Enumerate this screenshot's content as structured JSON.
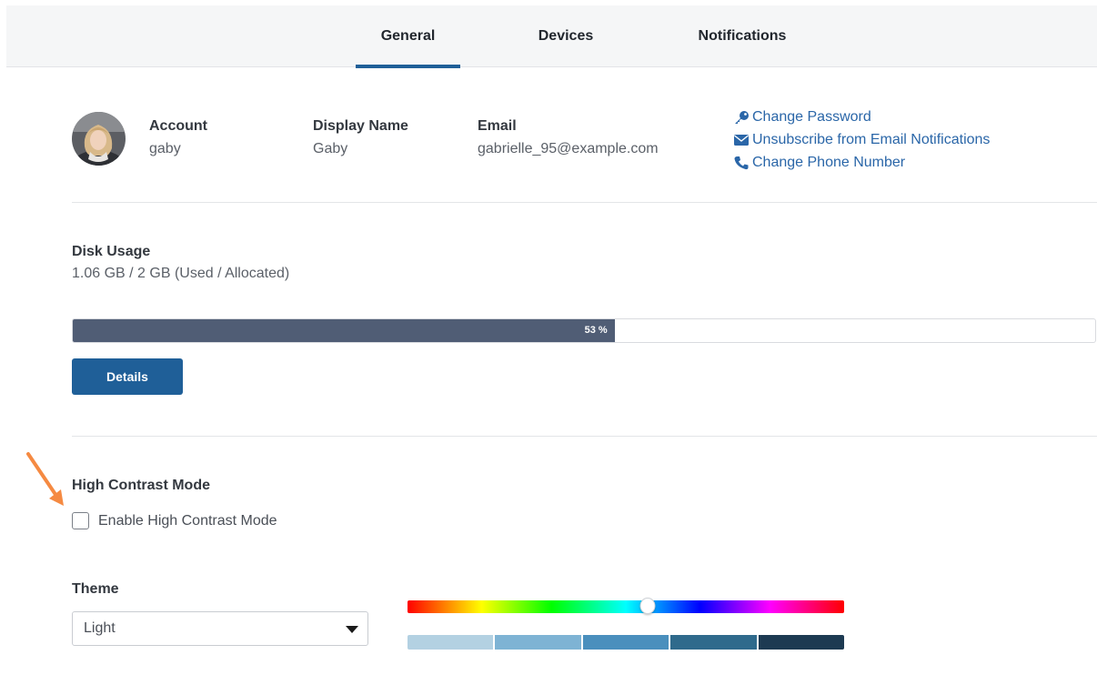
{
  "tabs": [
    {
      "label": "General",
      "active": true
    },
    {
      "label": "Devices",
      "active": false
    },
    {
      "label": "Notifications",
      "active": false
    }
  ],
  "account": {
    "account_label": "Account",
    "account_value": "gaby",
    "display_name_label": "Display Name",
    "display_name_value": "Gaby",
    "email_label": "Email",
    "email_value": "gabrielle_95@example.com"
  },
  "links": [
    {
      "label": "Change Password",
      "icon": "key-icon"
    },
    {
      "label": "Unsubscribe from Email Notifications",
      "icon": "envelope-icon"
    },
    {
      "label": "Change Phone Number",
      "icon": "phone-icon"
    }
  ],
  "disk": {
    "title": "Disk Usage",
    "summary": "1.06 GB / 2 GB (Used / Allocated)",
    "percent_label": "53 %",
    "percent": 53,
    "details_label": "Details"
  },
  "high_contrast": {
    "title": "High Contrast Mode",
    "checkbox_label": "Enable High Contrast Mode",
    "checked": false
  },
  "theme": {
    "title": "Theme",
    "selected": "Light",
    "hue_percent": 55,
    "swatches": [
      "#b3d1e2",
      "#7eb3d4",
      "#4a8fbd",
      "#2f6a8c",
      "#1d3a52"
    ]
  },
  "colors": {
    "accent": "#1f5f98",
    "progress": "#505d75",
    "link": "#2a66a8",
    "arrow": "#f58a42"
  }
}
